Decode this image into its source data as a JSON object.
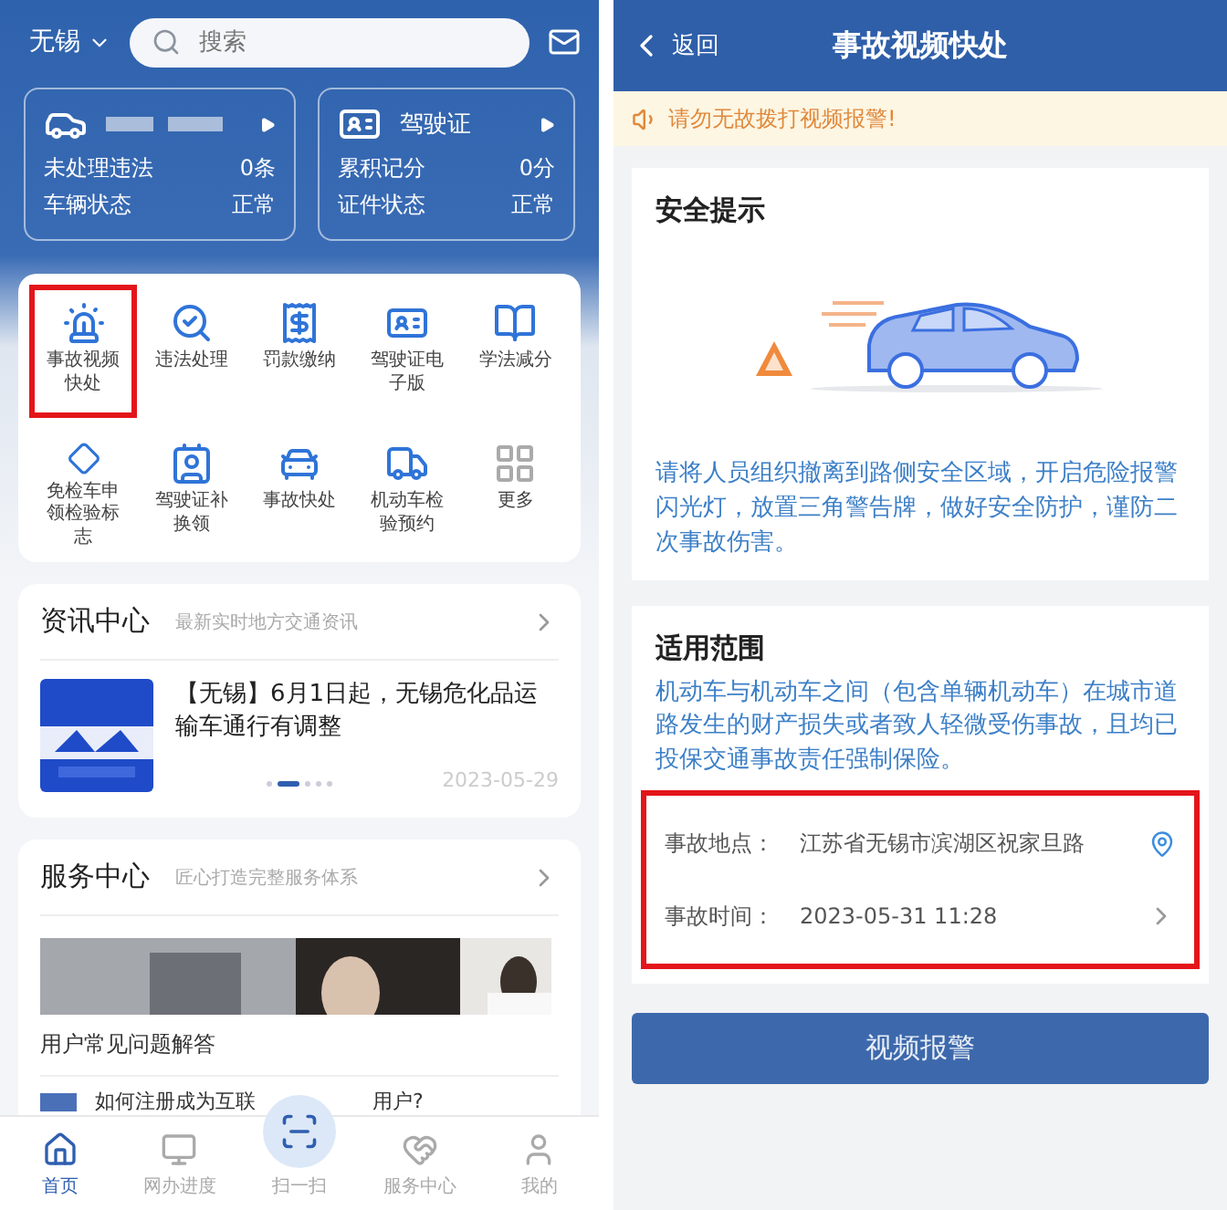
{
  "home": {
    "city": "无锡",
    "search": {
      "placeholder": "搜索"
    },
    "vehicle_card": {
      "rows": [
        {
          "label": "未处理违法",
          "value": "0条"
        },
        {
          "label": "车辆状态",
          "value": "正常"
        }
      ]
    },
    "license_card": {
      "title": "驾驶证",
      "rows": [
        {
          "label": "累积记分",
          "value": "0分"
        },
        {
          "label": "证件状态",
          "value": "正常"
        }
      ]
    },
    "services": [
      {
        "label": "事故视频快处",
        "highlighted": true
      },
      {
        "label": "违法处理",
        "highlighted": false
      },
      {
        "label": "罚款缴纳",
        "highlighted": false
      },
      {
        "label": "驾驶证电子版",
        "highlighted": false
      },
      {
        "label": "学法减分",
        "highlighted": false
      },
      {
        "label": "免检车申领检验标志",
        "highlighted": false
      },
      {
        "label": "驾驶证补换领",
        "highlighted": false
      },
      {
        "label": "事故快处",
        "highlighted": false
      },
      {
        "label": "机动车检验预约",
        "highlighted": false
      },
      {
        "label": "更多",
        "highlighted": false
      }
    ],
    "news": {
      "title": "资讯中心",
      "subtitle": "最新实时地方交通资讯",
      "headline": "【无锡】6月1日起，无锡危化品运输车通行有调整",
      "date": "2023-05-29",
      "dots": [
        {
          "selected": false
        },
        {
          "selected": true
        },
        {
          "selected": false
        },
        {
          "selected": false
        },
        {
          "selected": false
        }
      ]
    },
    "service_center": {
      "title": "服务中心",
      "subtitle": "匠心打造完整服务体系",
      "faq_title": "用户常见问题解答",
      "faq_item_start": "如何注册成为互联",
      "faq_item_end": "用户?"
    },
    "tabs": [
      {
        "label": "首页",
        "selected": true
      },
      {
        "label": "网办进度",
        "selected": false
      },
      {
        "label": "扫一扫",
        "selected": false
      },
      {
        "label": "服务中心",
        "selected": false
      },
      {
        "label": "我的",
        "selected": false
      }
    ]
  },
  "detail": {
    "back": "返回",
    "title": "事故视频快处",
    "notice": "请勿无故拨打视频报警!",
    "safety": {
      "title": "安全提示",
      "text": "请将人员组织撤离到路侧安全区域，开启危险报警闪光灯，放置三角警告牌，做好安全防护，谨防二次事故伤害。"
    },
    "scope": {
      "title": "适用范围",
      "text": "机动车与机动车之间（包含单辆机动车）在城市道路发生的财产损失或者致人轻微受伤事故，且均已投保交通事故责任强制保险。"
    },
    "fields": {
      "highlighted": true,
      "items": [
        {
          "label": "事故地点：",
          "value": "江苏省无锡市滨湖区祝家旦路",
          "kind": "location"
        },
        {
          "label": "事故时间：",
          "value": "2023-05-31 11:28",
          "kind": "picker"
        }
      ]
    },
    "submit": "视频报警"
  }
}
